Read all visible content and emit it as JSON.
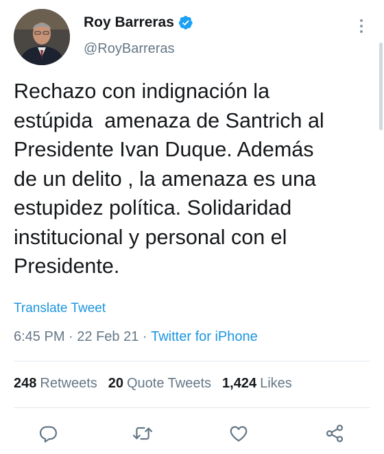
{
  "author": {
    "display_name": "Roy Barreras",
    "handle": "@RoyBarreras",
    "verified": true,
    "avatar_icon": "profile-photo"
  },
  "tweet": {
    "text": "Rechazo con indignación la\nestúpida  amenaza de Santrich al\nPresidente Ivan Duque. Además\nde un delito , la amenaza es una\nestupidez política. Solidaridad\ninstitucional y personal con el\nPresidente.",
    "translate_label": "Translate Tweet",
    "time": "6:45 PM",
    "separator1": " · ",
    "date": "22 Feb 21",
    "separator2": " · ",
    "source": "Twitter for iPhone"
  },
  "stats": {
    "retweets_count": "248",
    "retweets_label": "Retweets",
    "quotes_count": "20",
    "quotes_label": "Quote Tweets",
    "likes_count": "1,424",
    "likes_label": "Likes"
  },
  "actions": [
    "reply-icon",
    "retweet-icon",
    "like-icon",
    "share-icon"
  ],
  "colors": {
    "accent": "#1b95e0",
    "secondary_text": "#657786",
    "icon": "#657786",
    "divider": "#e1e8ed"
  }
}
